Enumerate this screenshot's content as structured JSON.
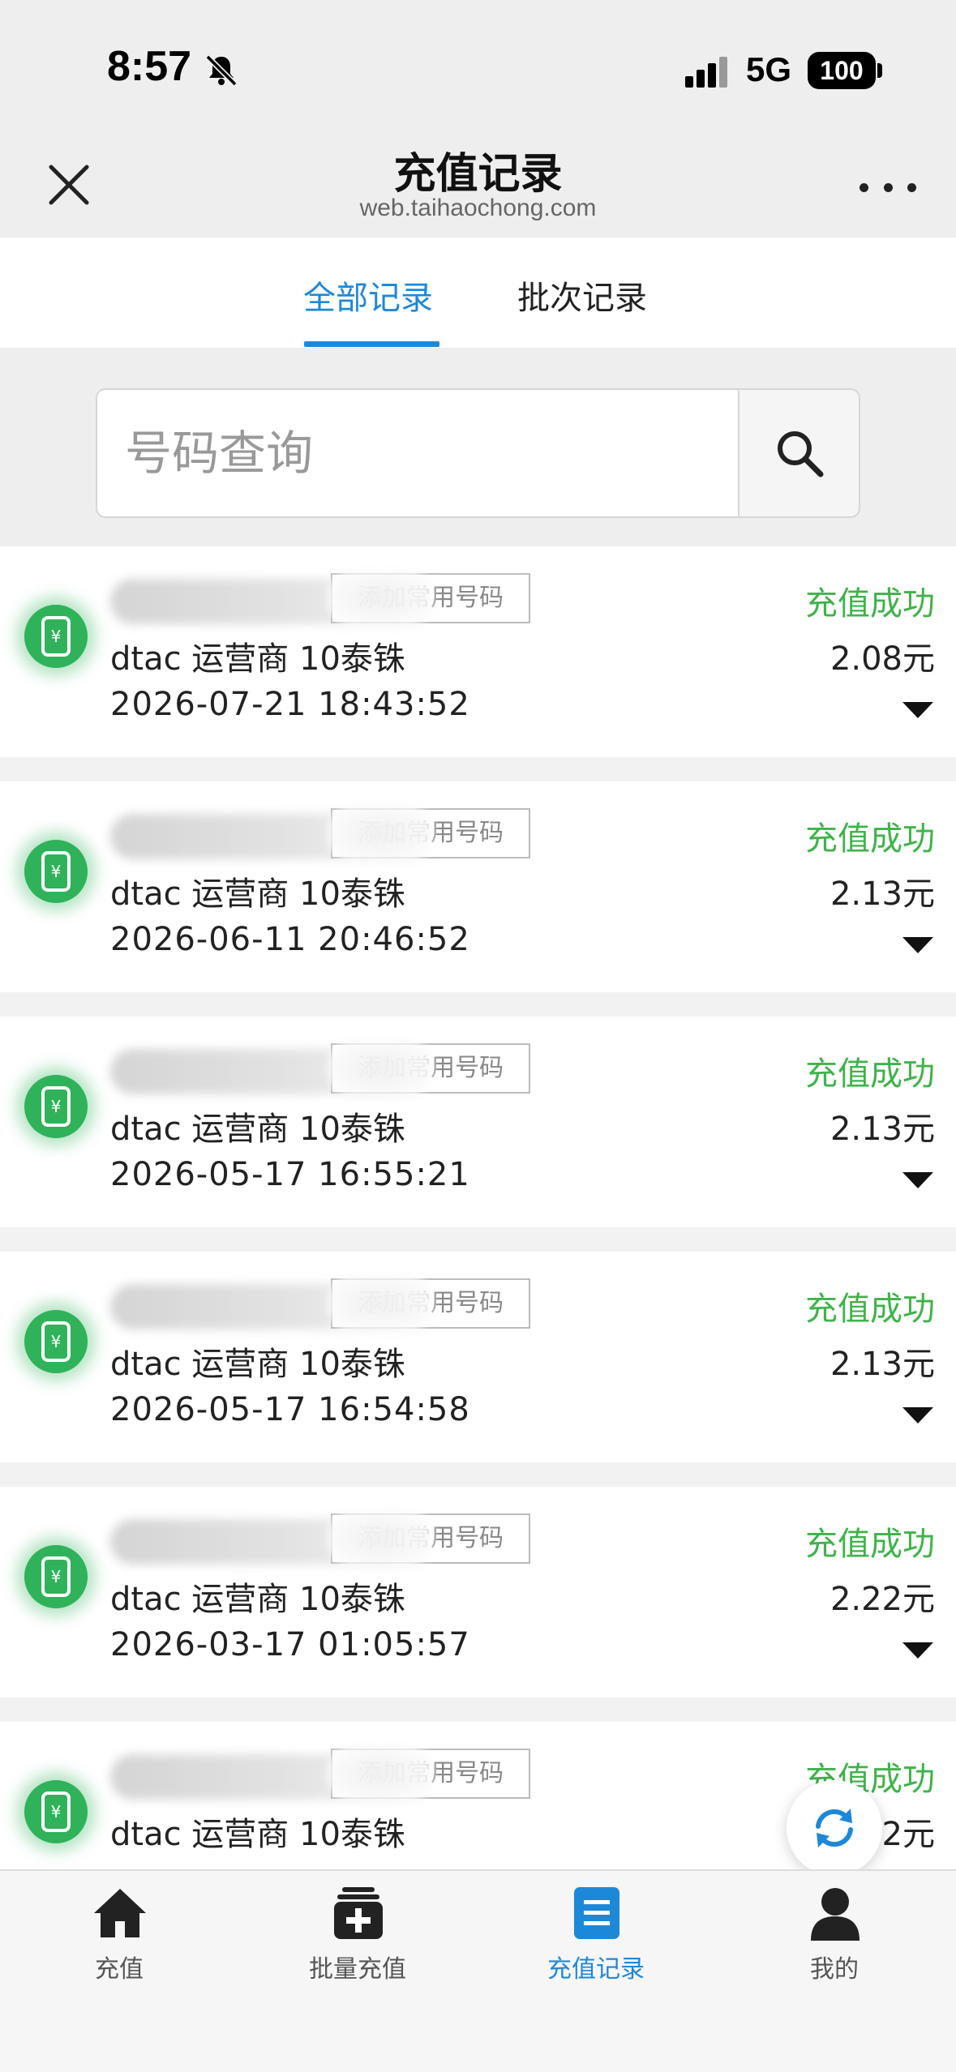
{
  "status_bar": {
    "time": "8:57",
    "network": "5G",
    "battery": "100"
  },
  "header": {
    "title": "充值记录",
    "url": "web.taihaochong.com"
  },
  "tabs": [
    {
      "label": "全部记录",
      "active": true
    },
    {
      "label": "批次记录",
      "active": false
    }
  ],
  "search": {
    "placeholder": "号码查询"
  },
  "records": [
    {
      "fav_label": "添加常用号码",
      "carrier": "dtac 运营商 10泰铢",
      "time": "2026-07-21 18:43:52",
      "status": "充值成功",
      "amount": "2.08元"
    },
    {
      "fav_label": "添加常用号码",
      "carrier": "dtac 运营商 10泰铢",
      "time": "2026-06-11 20:46:52",
      "status": "充值成功",
      "amount": "2.13元"
    },
    {
      "fav_label": "添加常用号码",
      "carrier": "dtac 运营商 10泰铢",
      "time": "2026-05-17 16:55:21",
      "status": "充值成功",
      "amount": "2.13元"
    },
    {
      "fav_label": "添加常用号码",
      "carrier": "dtac 运营商 10泰铢",
      "time": "2026-05-17 16:54:58",
      "status": "充值成功",
      "amount": "2.13元"
    },
    {
      "fav_label": "添加常用号码",
      "carrier": "dtac 运营商 10泰铢",
      "time": "2026-03-17 01:05:57",
      "status": "充值成功",
      "amount": "2.22元"
    },
    {
      "fav_label": "添加常用号码",
      "carrier": "dtac 运营商 10泰铢",
      "time": "",
      "status": "充值成功",
      "amount": "2.22元"
    }
  ],
  "bottom_nav": [
    {
      "label": "充值",
      "icon": "home-icon",
      "active": false
    },
    {
      "label": "批量充值",
      "icon": "batch-add-icon",
      "active": false
    },
    {
      "label": "充值记录",
      "icon": "records-icon",
      "active": true
    },
    {
      "label": "我的",
      "icon": "user-icon",
      "active": false
    }
  ],
  "colors": {
    "accent": "#1e88d8",
    "success": "#3fb349",
    "icon_green": "#2fb25a"
  }
}
